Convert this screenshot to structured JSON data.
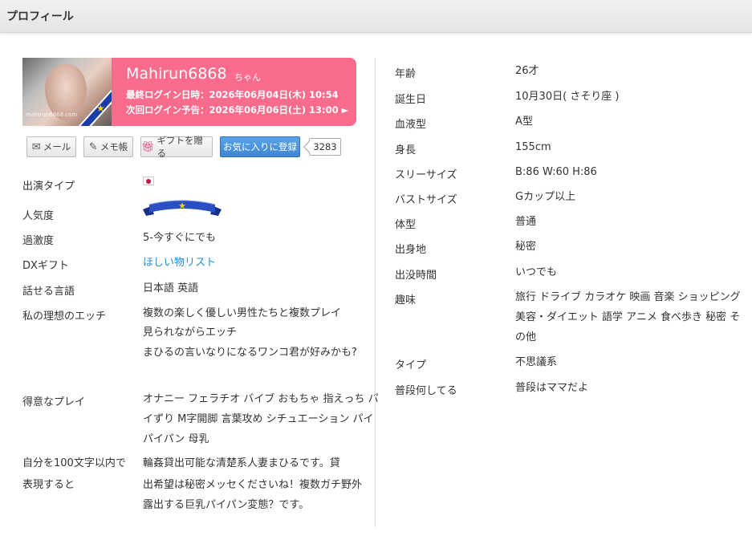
{
  "page": {
    "title": "プロフィール"
  },
  "profile": {
    "name": "Mahirun6868",
    "honorific": "ちゃん",
    "last_login": "最終ログイン日時：2026年06月04日(木) 10:54",
    "next_login": "次回ログイン予告：2026年06月06日(土) 13:00 ►",
    "thumb_watermark": "mahirun6868.com"
  },
  "actions": {
    "mail": "メール",
    "memo": "メモ帳",
    "gift": "ギフトを贈る",
    "favorite": "お気に入りに登録",
    "favorite_count": "3283"
  },
  "left": {
    "type": {
      "label": "出演タイプ"
    },
    "popularity": {
      "label": "人気度"
    },
    "intensity": {
      "label": "過激度",
      "value": "5-今すぐにでも"
    },
    "dx_gift": {
      "label": "DXギフト",
      "value": "ほしい物リスト"
    },
    "languages": {
      "label": "話せる言語",
      "value": "日本語 英語"
    },
    "ideal": {
      "label": "私の理想のエッチ",
      "lines": [
        "複数の楽しく優しい男性たちと複数プレイ",
        "見られながらエッチ",
        "まひるの言いなりになるワンコ君が好みかも?"
      ]
    },
    "good_play": {
      "label": "得意なプレイ",
      "lines": [
        "オナニー フェラチオ バイブ おもちゃ 指えっち パ",
        "イずり M字開脚 言葉攻め シチュエーション パイ",
        "パイパン 母乳"
      ]
    },
    "intro": {
      "label_lines": [
        "自分を100文字以内で",
        "表現すると"
      ],
      "lines": [
        "輪姦貸出可能な清楚系人妻まひるです。貸",
        "出希望は秘密メッセくださいね！複数ガチ野外",
        "露出する巨乳パイパン変態？です。"
      ]
    }
  },
  "right": {
    "age": {
      "label": "年齢",
      "value": "26才"
    },
    "birthday": {
      "label": "誕生日",
      "value": "10月30日( さそり座 )"
    },
    "blood": {
      "label": "血液型",
      "value": "A型"
    },
    "height": {
      "label": "身長",
      "value": "155cm"
    },
    "three_size": {
      "label": "スリーサイズ",
      "value": "B:86 W:60 H:86"
    },
    "bust": {
      "label": "バストサイズ",
      "value": "Gカップ以上"
    },
    "body": {
      "label": "体型",
      "value": "普通"
    },
    "hometown": {
      "label": "出身地",
      "value": "秘密"
    },
    "active_time": {
      "label": "出没時間",
      "value": "いつでも"
    },
    "hobbies": {
      "label": "趣味",
      "lines": [
        "旅行 ドライブ カラオケ 映画 音楽 ショッピング",
        "美容・ダイエット 語学 アニメ 食べ歩き 秘密 そ",
        "の他"
      ]
    },
    "type": {
      "label": "タイプ",
      "value": "不思議系"
    },
    "usual": {
      "label": "普段何してる",
      "value": "普段はママだよ"
    }
  },
  "colors": {
    "nameplate": "#fb6b8c",
    "favorite_button": "#4a94dd",
    "link": "#1e8fd6",
    "popularity_ribbon": "#1a3ca8",
    "star": "#f6d000"
  },
  "icons": {
    "mail": "envelope-icon",
    "memo": "edit-icon",
    "gift": "gift-icon",
    "flag": "japan-flag-icon",
    "ribbon": "ribbon-star-icon"
  }
}
